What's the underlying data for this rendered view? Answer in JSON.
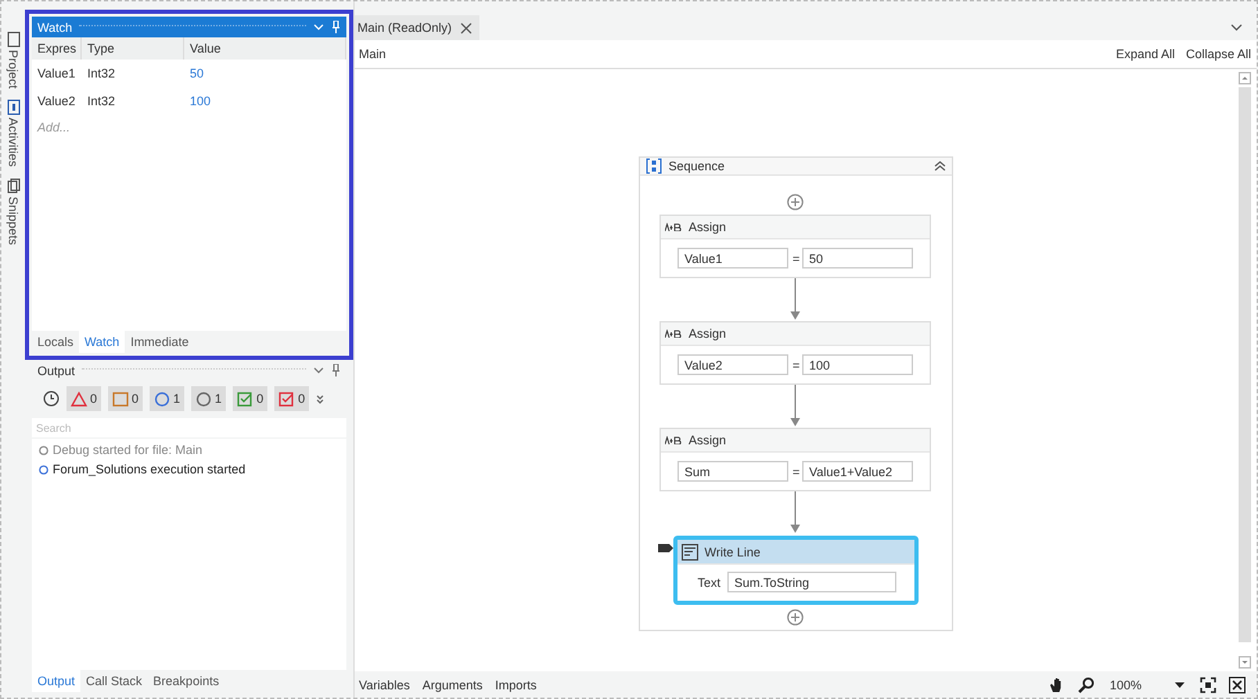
{
  "side_tabs": [
    {
      "label": "Project",
      "kind": "page"
    },
    {
      "label": "Activities",
      "kind": "activities"
    },
    {
      "label": "Snippets",
      "kind": "snippets"
    }
  ],
  "watch": {
    "title": "Watch",
    "columns": [
      "Expres",
      "Type",
      "Value"
    ],
    "rows": [
      {
        "expression": "Value1",
        "type": "Int32",
        "value": "50"
      },
      {
        "expression": "Value2",
        "type": "Int32",
        "value": "100"
      }
    ],
    "add_hint": "Add...",
    "tabs": [
      {
        "label": "Locals",
        "selected": false
      },
      {
        "label": "Watch",
        "selected": true
      },
      {
        "label": "Immediate",
        "selected": false
      }
    ]
  },
  "output": {
    "title": "Output",
    "filters": [
      {
        "kind": "error",
        "count": "0"
      },
      {
        "kind": "warning",
        "count": "0"
      },
      {
        "kind": "info",
        "count": "1"
      },
      {
        "kind": "trace",
        "count": "1"
      },
      {
        "kind": "success",
        "count": "0"
      },
      {
        "kind": "failure",
        "count": "0"
      }
    ],
    "search": {
      "placeholder": "Search"
    },
    "messages": [
      {
        "text": "Debug started for file: Main",
        "kind": "trace"
      },
      {
        "text": "Forum_Solutions execution started",
        "kind": "info"
      }
    ],
    "tabs": [
      {
        "label": "Output",
        "selected": true
      },
      {
        "label": "Call Stack",
        "selected": false
      },
      {
        "label": "Breakpoints",
        "selected": false
      }
    ]
  },
  "designer": {
    "tab": {
      "label": "Main (ReadOnly)",
      "selected": true
    },
    "breadcrumb": "Main",
    "actions": [
      "Expand All",
      "Collapse All"
    ],
    "sequence": {
      "title": "Sequence",
      "activities": [
        {
          "kind": "assign",
          "title": "Assign",
          "to": "Value1",
          "operator": "=",
          "value": "50",
          "selected": false
        },
        {
          "kind": "assign",
          "title": "Assign",
          "to": "Value2",
          "operator": "=",
          "value": "100",
          "selected": false
        },
        {
          "kind": "assign",
          "title": "Assign",
          "to": "Sum",
          "operator": "=",
          "value": "Value1+Value2",
          "selected": false
        },
        {
          "kind": "write_line",
          "title": "Write Line",
          "label": "Text",
          "value": "Sum.ToString",
          "selected": true
        }
      ]
    },
    "bottom_tabs": [
      "Variables",
      "Arguments",
      "Imports"
    ],
    "zoom": "100%"
  }
}
